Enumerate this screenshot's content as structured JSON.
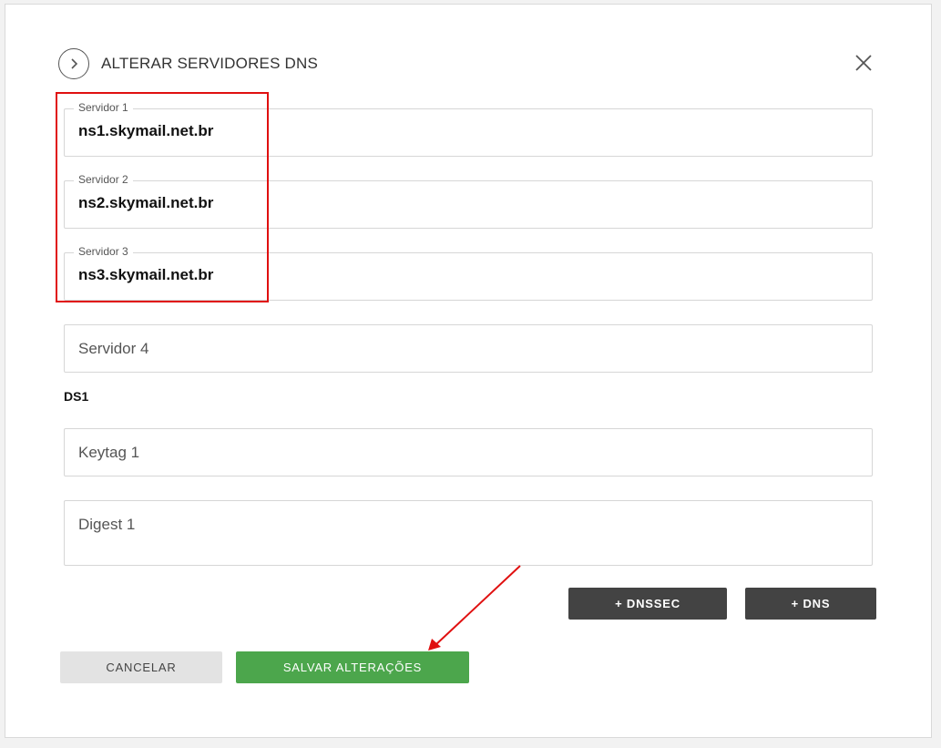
{
  "modal": {
    "title": "ALTERAR SERVIDORES DNS"
  },
  "fields": {
    "servidor1": {
      "label": "Servidor 1",
      "value": "ns1.skymail.net.br"
    },
    "servidor2": {
      "label": "Servidor 2",
      "value": "ns2.skymail.net.br"
    },
    "servidor3": {
      "label": "Servidor 3",
      "value": "ns3.skymail.net.br"
    },
    "servidor4": {
      "placeholder": "Servidor 4"
    }
  },
  "ds_section": {
    "label": "DS1",
    "keytag_placeholder": "Keytag 1",
    "digest_placeholder": "Digest 1"
  },
  "buttons": {
    "add_dnssec": "+ DNSSEC",
    "add_dns": "+ DNS",
    "cancel": "CANCELAR",
    "save": "SALVAR ALTERAÇÕES"
  },
  "colors": {
    "save_green": "#4ca64c",
    "dark_button": "#434343",
    "annotation_red": "#e01010"
  }
}
